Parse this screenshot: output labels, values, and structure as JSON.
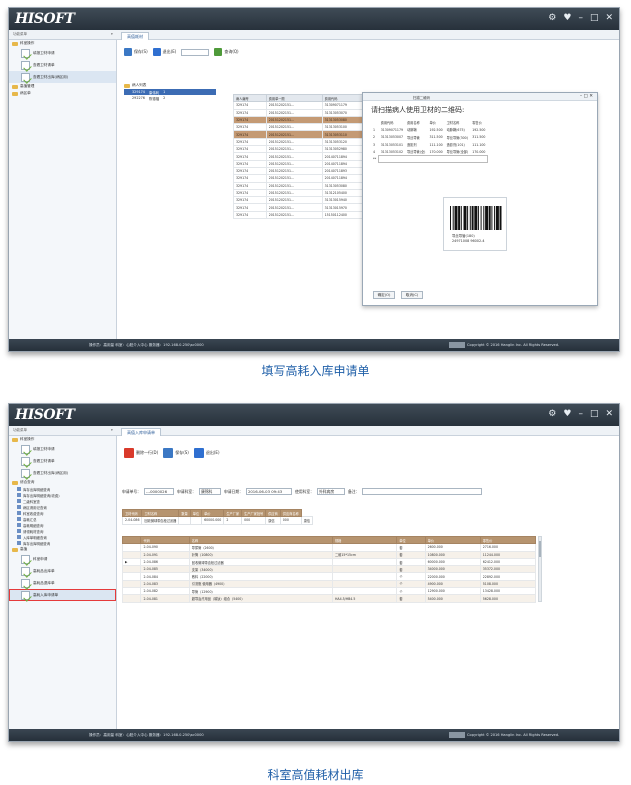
{
  "colors": {
    "brand_title": "#2f3a45",
    "accent_blue": "#1f5fa8",
    "row_highlight": "#c49a74",
    "grid_header_tan": "#b6946f",
    "selection_outline": "#e53b3b"
  },
  "window": {
    "logo": "HISOFT",
    "controls": [
      "⚙",
      "♥",
      "–",
      "□",
      "✕"
    ]
  },
  "screen1": {
    "tab_label": "高值耗材",
    "sidebar": {
      "top_label": "功能菜单",
      "groups": [
        {
          "label": "科室操作",
          "items": [
            "填报卫材申请",
            "查看卫材请单",
            "查看卫材出库(病区用)"
          ]
        },
        {
          "label": "高值管理",
          "items": []
        },
        {
          "label": "病区单",
          "items": []
        }
      ]
    },
    "toolbar": {
      "save_label": "保存(S)",
      "exit_label": "退出(E)",
      "query_label": "查询(Q)"
    },
    "patient_list": {
      "title": "病人列表",
      "rows": [
        {
          "bed": "329174",
          "name": "康伟利",
          "num": "1"
        },
        {
          "bed": "292276",
          "name": "陈德福",
          "num": "2"
        }
      ]
    },
    "request_grid": {
      "columns": [
        "病人编号",
        "费用单一顾",
        "费用代码"
      ],
      "rows": [
        [
          "329174",
          "20151202151...",
          "31309071179"
        ],
        [
          "329174",
          "20151202151...",
          "31313053070"
        ],
        [
          "329174",
          "20151202151...",
          "31313053080"
        ],
        [
          "329174",
          "20151202151...",
          "31313053100"
        ],
        [
          "329174",
          "20151202151...",
          "31313053110"
        ],
        [
          "329174",
          "20151202151...",
          "31313053120"
        ],
        [
          "329174",
          "20151202151...",
          "31313052980"
        ],
        [
          "329174",
          "20151202151...",
          "20140711894"
        ],
        [
          "329174",
          "20151202151...",
          "20140711894"
        ],
        [
          "329174",
          "20151202151...",
          "20140711893"
        ],
        [
          "329174",
          "20151202151...",
          "20140711894"
        ],
        [
          "329174",
          "20151202151...",
          "31313053080"
        ],
        [
          "329174",
          "20151202151...",
          "31312105400"
        ],
        [
          "329174",
          "20151202151...",
          "31313015940"
        ],
        [
          "329174",
          "20151202151...",
          "31313015970"
        ],
        [
          "329174",
          "20151202151...",
          "15150112400"
        ]
      ],
      "highlighted_rows": [
        2,
        4
      ]
    },
    "dialog": {
      "title": "扫描二维码",
      "message": "请扫描病人使用卫材的二维码:",
      "columns": [
        "",
        "费用代码",
        "费用名称",
        "单价",
        "卫材名称",
        "零售价"
      ],
      "rows": [
        [
          "1",
          "31309071179",
          "动脉鞘",
          "192.500",
          "动脉鞘(675)",
          "192.500"
        ],
        [
          "2",
          "31313053007",
          "导丝导管",
          "311.500",
          "导丝导管(300)",
          "311.500"
        ],
        [
          "3",
          "31313053101",
          "造影剂",
          "111.100",
          "造影剂(101)",
          "111.100"
        ],
        [
          "4",
          "31313053102",
          "导丝导管(全)",
          "170.000",
          "导丝导管(全部)",
          "170.000"
        ]
      ],
      "new_row_marker": "**",
      "barcode_name": "导丝导管(180)",
      "barcode_code": "24971008 96002-4",
      "btn_confirm": "确定(O)",
      "btn_cancel": "取消(C)"
    },
    "status": {
      "left": "操作员：高用量  科室：心脏介入中心  服务器：192.168.0.250\\sc0000",
      "right": "Copyright © 2016 Hanglin Inc. All Rights Reserved."
    },
    "caption": "填写高耗入库申请单"
  },
  "screen2": {
    "tab_label": "高值入库申请单",
    "sidebar": {
      "top_label": "功能菜单",
      "group1": {
        "label": "科室操作",
        "items": [
          "填报卫材申请",
          "查看卫材请单",
          "查看卫材出库(病区用)"
        ]
      },
      "group2": {
        "label": "综合查询",
        "leaves": [
          "库存出库明细查询",
          "库存出库明细查询(收费)",
          "二级科室查",
          "病区请用记查询",
          "科室收费查询",
          "高耗汇总",
          "高耗明细查询",
          "请领耗材查询",
          "入库单明细查询",
          "库存出库明细查询"
        ]
      },
      "group3": {
        "label": "高值",
        "items": [
          "科室申请",
          "高耗品出库单",
          "高耗品退库单",
          "高耗入库申请单"
        ]
      },
      "boxed_item": "高耗入库申请单"
    },
    "toolbar": {
      "delete_label": "删除一行(D)",
      "save_label": "保存(S)",
      "exit_label": "退出(E)"
    },
    "form": {
      "order_label": "申请单号：",
      "order_value": "---0000026",
      "applicant_label": "申请科室：",
      "applicant_value": "康锦科",
      "date_label": "申请日期：",
      "date_value": "2016-06-03 09:43",
      "user_label": "使用科室：",
      "user_value": "外科病房",
      "remark_label": "备注："
    },
    "top_grid": {
      "columns": [
        "卫材代码",
        "卫材名称",
        "数量",
        "单位",
        "单价",
        "生产厂家",
        "生产厂家批号",
        "供应商",
        "供应商名称"
      ],
      "row": [
        "2-04-086",
        "回收微球带血栓过滤器",
        "",
        "",
        "60000.000",
        "2",
        "000",
        "康信",
        "000",
        "康信"
      ]
    },
    "main_grid": {
      "columns": [
        "",
        "代码",
        "名称",
        "规格",
        "单位",
        "单价",
        "零售价"
      ],
      "rows": [
        [
          "",
          "2-04-090",
          "导尿管（2600）",
          "",
          "套",
          "2600.000",
          "2716.000"
        ],
        [
          "",
          "2-04-091",
          "针筒（10800）",
          "二维15*15cm",
          "套",
          "10800.000",
          "11244.000"
        ],
        [
          "▶",
          "2-04-086",
          "回收微球带血栓过滤器",
          "",
          "套",
          "60000.000",
          "62412.000"
        ],
        [
          "",
          "2-04-085",
          "支架（34000）",
          "",
          "套",
          "34000.000",
          "35372.000"
        ],
        [
          "",
          "2-04-084",
          "敷料（22000）",
          "",
          "个",
          "22000.000",
          "22892.000"
        ],
        [
          "",
          "2-04-083",
          "引流瓶 使用器（4900）",
          "",
          "个",
          "4900.000",
          "5108.000"
        ],
        [
          "",
          "2-04-082",
          "导管（12900）",
          "",
          "个",
          "12900.000",
          "13428.000"
        ],
        [
          "",
          "2-04-081",
          "超导治疗用品（碳钛）组合（5400）",
          "HA4.5/HB4.5",
          "套",
          "5400.000",
          "5628.000"
        ]
      ]
    },
    "status": {
      "left": "操作员：高用量  科室：心脏介入中心  服务器：192.168.0.250\\sc0000",
      "right": "Copyright © 2016 Hanglin Inc. All Rights Reserved."
    },
    "caption": "科室高值耗材出库"
  }
}
